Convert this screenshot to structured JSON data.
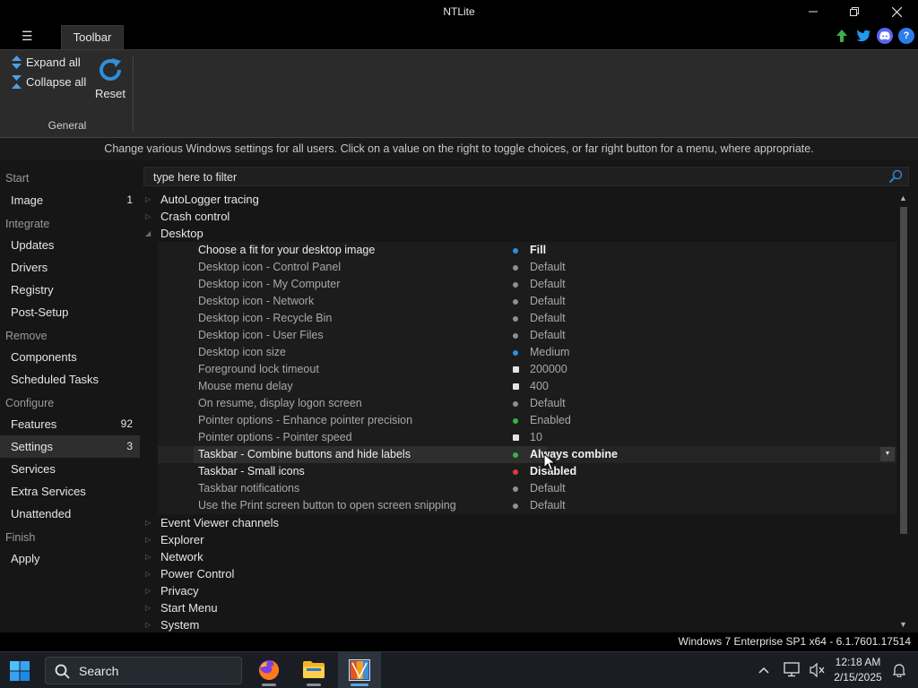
{
  "window": {
    "title": "NTLite",
    "minimize_icon": "minimize-icon",
    "restore_icon": "restore-icon",
    "close_icon": "close-icon"
  },
  "ribbon": {
    "tab_label": "Toolbar",
    "expand_all": "Expand all",
    "collapse_all": "Collapse all",
    "reset": "Reset",
    "group_label": "General"
  },
  "top_icons": [
    "update-arrow-icon",
    "twitter-icon",
    "discord-icon",
    "help-icon"
  ],
  "info_text": "Change various Windows settings for all users. Click on a value on the right to toggle choices, or far right button for a menu, where appropriate.",
  "filter": {
    "placeholder": "type here to filter"
  },
  "sidebar": {
    "start": {
      "label": "Start",
      "items": [
        {
          "label": "Image",
          "count": "1"
        }
      ]
    },
    "integrate": {
      "label": "Integrate",
      "items": [
        {
          "label": "Updates"
        },
        {
          "label": "Drivers"
        },
        {
          "label": "Registry"
        },
        {
          "label": "Post-Setup"
        }
      ]
    },
    "remove": {
      "label": "Remove",
      "items": [
        {
          "label": "Components"
        },
        {
          "label": "Scheduled Tasks"
        }
      ]
    },
    "configure": {
      "label": "Configure",
      "items": [
        {
          "label": "Features",
          "count": "92"
        },
        {
          "label": "Settings",
          "count": "3"
        },
        {
          "label": "Services"
        },
        {
          "label": "Extra Services"
        },
        {
          "label": "Unattended"
        }
      ]
    },
    "finish": {
      "label": "Finish",
      "items": [
        {
          "label": "Apply"
        }
      ]
    }
  },
  "tree": {
    "top_nodes": [
      "AutoLogger tracing",
      "Crash control",
      "Desktop"
    ],
    "desktop_settings": [
      {
        "name": "Choose a fit for your desktop image",
        "value": "Fill",
        "marker": "dot",
        "color": "#2f8fdc"
      },
      {
        "name": "Desktop icon - Control Panel",
        "value": "Default",
        "marker": "dot",
        "color": "#8f8f8f"
      },
      {
        "name": "Desktop icon - My Computer",
        "value": "Default",
        "marker": "dot",
        "color": "#8f8f8f"
      },
      {
        "name": "Desktop icon - Network",
        "value": "Default",
        "marker": "dot",
        "color": "#8f8f8f"
      },
      {
        "name": "Desktop icon - Recycle Bin",
        "value": "Default",
        "marker": "dot",
        "color": "#8f8f8f"
      },
      {
        "name": "Desktop icon - User Files",
        "value": "Default",
        "marker": "dot",
        "color": "#8f8f8f"
      },
      {
        "name": "Desktop icon size",
        "value": "Medium",
        "marker": "dot",
        "color": "#2f8fdc"
      },
      {
        "name": "Foreground lock timeout",
        "value": "200000",
        "marker": "square",
        "color": "#e4e4e4"
      },
      {
        "name": "Mouse menu delay",
        "value": "400",
        "marker": "square",
        "color": "#e4e4e4"
      },
      {
        "name": "On resume, display logon screen",
        "value": "Default",
        "marker": "dot",
        "color": "#8f8f8f"
      },
      {
        "name": "Pointer options - Enhance pointer precision",
        "value": "Enabled",
        "marker": "dot",
        "color": "#3fae4c"
      },
      {
        "name": "Pointer options - Pointer speed",
        "value": "10",
        "marker": "square",
        "color": "#e4e4e4"
      },
      {
        "name": "Taskbar - Combine buttons and hide labels",
        "value": "Always combine",
        "marker": "dot",
        "color": "#3fae4c"
      },
      {
        "name": "Taskbar - Small icons",
        "value": "Disabled",
        "marker": "dot",
        "color": "#e03a3a"
      },
      {
        "name": "Taskbar notifications",
        "value": "Default",
        "marker": "dot",
        "color": "#8f8f8f"
      },
      {
        "name": "Use the Print screen button to open screen snipping",
        "value": "Default",
        "marker": "dot",
        "color": "#8f8f8f"
      }
    ],
    "bottom_nodes": [
      "Event Viewer channels",
      "Explorer",
      "Network",
      "Power Control",
      "Privacy",
      "Start Menu",
      "System"
    ]
  },
  "status": "Windows 7 Enterprise SP1 x64 - 6.1.7601.17514",
  "taskbar": {
    "search_label": "Search",
    "apps": [
      "firefox-icon",
      "file-explorer-icon",
      "ntlite-icon"
    ],
    "time": "12:18 AM",
    "date": "2/15/2025",
    "accent": "#60a6e8"
  }
}
